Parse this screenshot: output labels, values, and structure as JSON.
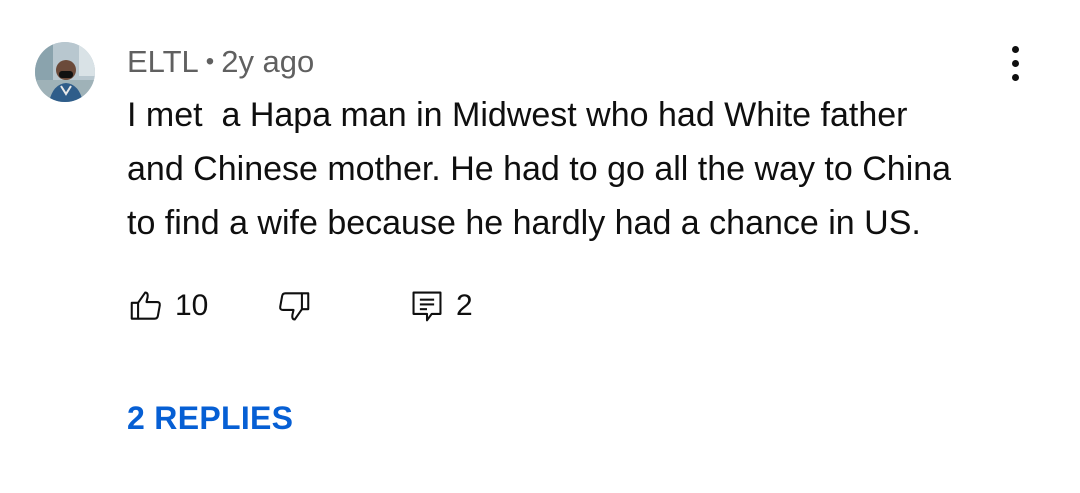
{
  "comment": {
    "author": "ELTL",
    "separator": "•",
    "time_ago": "2y ago",
    "text_lines": [
      "I met  a Hapa man in Midwest who had White father",
      "and Chinese mother. He had to go all the way to China",
      "to find a wife because he hardly had a chance in US."
    ]
  },
  "actions": {
    "like_count": "10",
    "reply_count": "2"
  },
  "replies": {
    "label": "2 REPLIES"
  },
  "icons": {
    "avatar": "avatar",
    "menu": "more-vert-icon",
    "like": "thumbs-up-icon",
    "dislike": "thumbs-down-icon",
    "reply": "reply-comment-icon"
  },
  "colors": {
    "link": "#065fd4",
    "meta": "#606060",
    "text": "#0f0f0f"
  }
}
